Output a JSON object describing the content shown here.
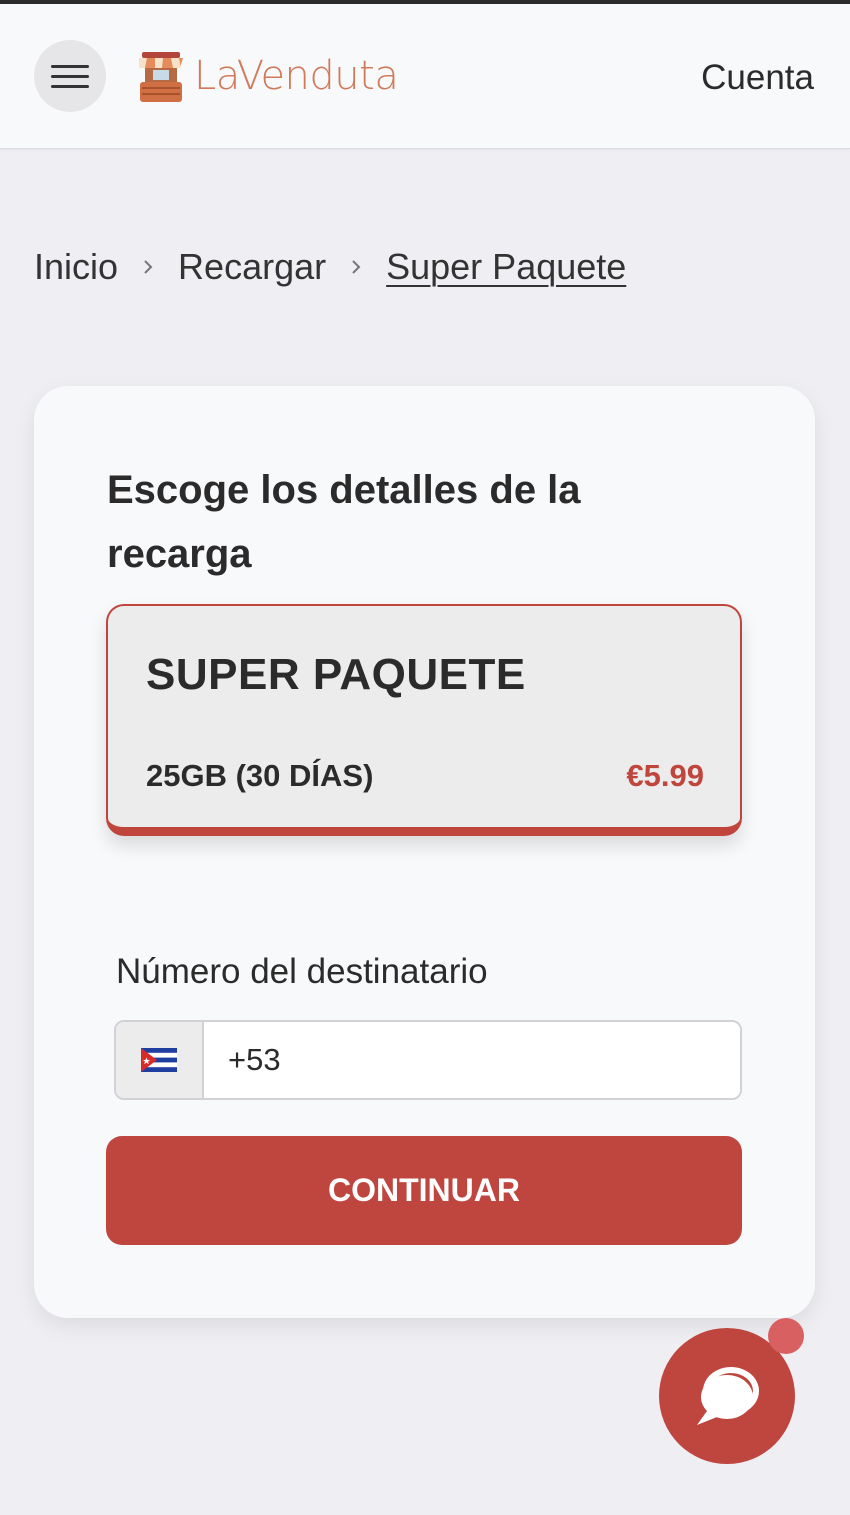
{
  "header": {
    "brand": "LaVenduta",
    "account_label": "Cuenta",
    "menu_icon": "hamburger-icon",
    "logo_icon": "market-stall-icon"
  },
  "breadcrumb": {
    "items": [
      "Inicio",
      "Recargar",
      "Super Paquete"
    ],
    "separator_icon": "chevron-right-icon"
  },
  "form": {
    "title": "Escoge los detalles de la recarga",
    "package": {
      "name": "SUPER PAQUETE",
      "detail": "25GB (30 DÍAS)",
      "price": "€5.99"
    },
    "recipient_label": "Número del destinatario",
    "phone_prefix": "+53",
    "country_flag_icon": "cuba-flag-icon",
    "submit_label": "CONTINUAR"
  },
  "chat": {
    "icon": "chat-bubbles-icon",
    "has_notification": true
  },
  "colors": {
    "accent": "#bf463e",
    "brand_text": "#d07a5a",
    "background": "#efeff3",
    "surface": "#f8f9fb"
  }
}
